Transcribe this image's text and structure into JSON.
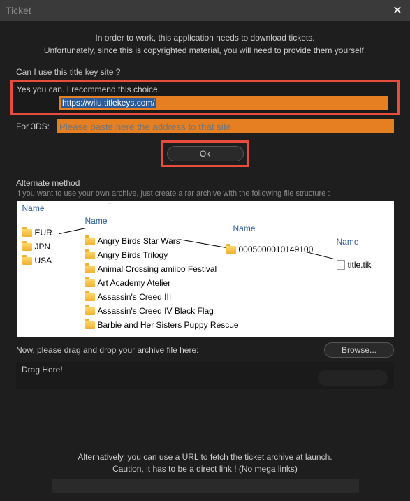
{
  "titlebar": {
    "title": "Ticket"
  },
  "intro": {
    "line1": "In order to work, this application needs to download tickets.",
    "line2": "Unfortunately, since this is copyrighted material, you will need to provide them yourself."
  },
  "section": {
    "question": "Can I use this title key site ?",
    "recommend": "Yes you can. I recommend this choice.",
    "wiiu_url": "https://wiiu.titlekeys.com/",
    "for3ds_label": "For 3DS:",
    "for3ds_placeholder": "Please paste here the address to that site",
    "ok_label": "Ok"
  },
  "alt": {
    "title": "Alternate method",
    "desc": "If you want to use your own archive, just create a rar archive with the following file structure :"
  },
  "explorer": {
    "header": "Name",
    "regions": [
      "EUR",
      "JPN",
      "USA"
    ],
    "games": [
      "Angry Birds Star Wars",
      "Angry Birds Trilogy",
      "Animal Crossing amiibo Festival",
      "Art Academy Atelier",
      "Assassin's Creed III",
      "Assassin's Creed IV Black Flag",
      "Barbie and Her Sisters Puppy Rescue"
    ],
    "titleid": "0005000010149100",
    "ticketfile": "title.tik"
  },
  "drag": {
    "prompt": "Now, please drag and drop your archive file here:",
    "browse": "Browse...",
    "draghere": "Drag Here!"
  },
  "urlfetch": {
    "line1": "Alternatively, you can use a URL to fetch the ticket archive at launch.",
    "line2": "Caution, it has to be a direct link ! (No mega links)"
  }
}
